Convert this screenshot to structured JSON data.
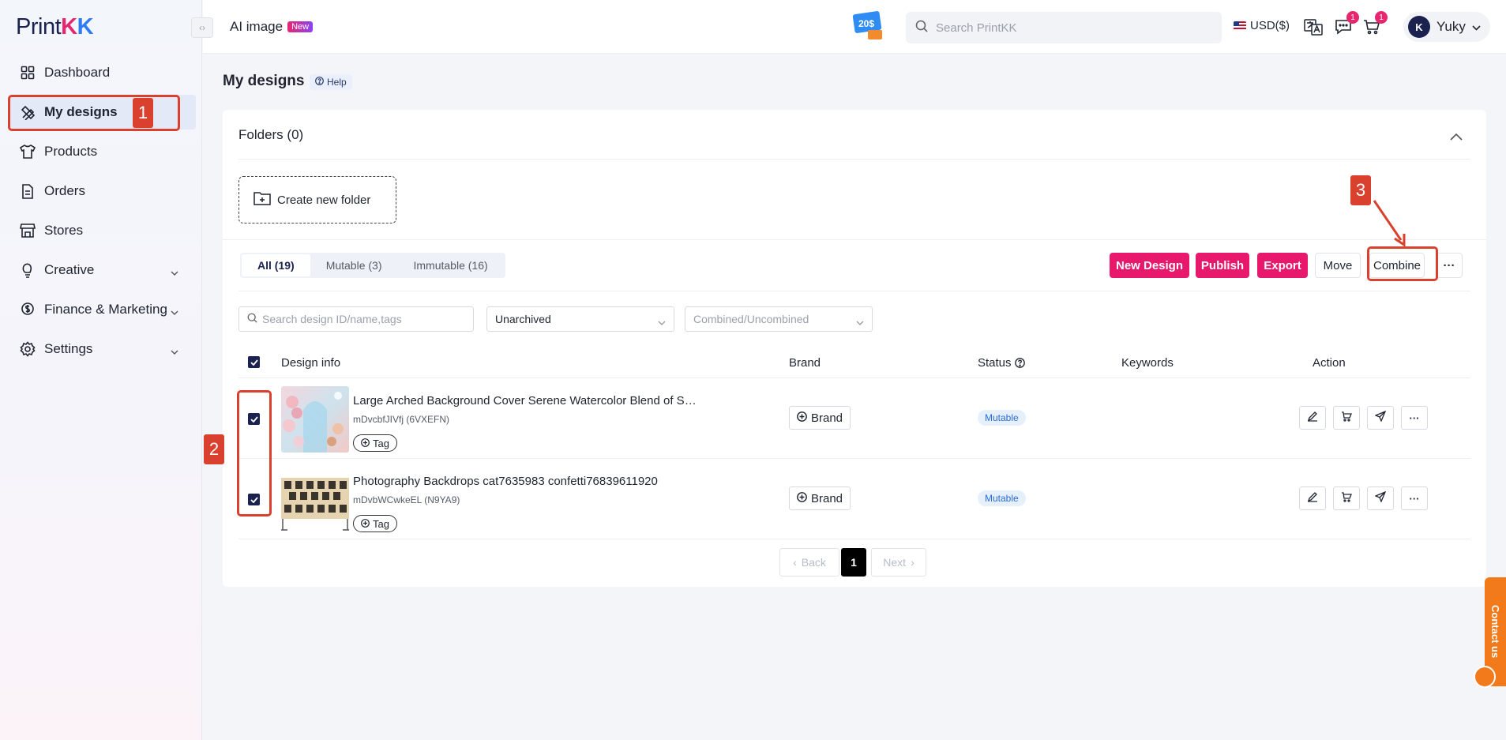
{
  "app": {
    "logo_text": "PrintKK",
    "logo_parts": [
      "Print",
      "K",
      "K"
    ]
  },
  "sidebar": {
    "items": [
      {
        "label": "Dashboard",
        "icon": "grid-icon"
      },
      {
        "label": "My designs",
        "icon": "pen-ruler-icon",
        "active": true
      },
      {
        "label": "Products",
        "icon": "tshirt-icon"
      },
      {
        "label": "Orders",
        "icon": "document-icon"
      },
      {
        "label": "Stores",
        "icon": "store-icon"
      },
      {
        "label": "Creative",
        "icon": "bulb-icon",
        "expandable": true
      },
      {
        "label": "Finance & Marketing",
        "icon": "dollar-icon",
        "expandable": true
      },
      {
        "label": "Settings",
        "icon": "gear-icon",
        "expandable": true
      }
    ]
  },
  "topbar": {
    "ai_image_label": "AI image",
    "new_badge": "New",
    "search_placeholder": "Search PrintKK",
    "currency": "USD($)",
    "messages_count": "1",
    "cart_count": "1",
    "user_name": "Yuky",
    "promo_text": "20$"
  },
  "page": {
    "title": "My designs",
    "help": "Help"
  },
  "folders": {
    "heading": "Folders (0)",
    "create_label": "Create new folder"
  },
  "tabs": [
    {
      "label": "All (19)",
      "active": true
    },
    {
      "label": "Mutable (3)"
    },
    {
      "label": "Immutable (16)"
    }
  ],
  "toolbar": {
    "new_design": "New Design",
    "publish": "Publish",
    "export": "Export",
    "move": "Move",
    "combine": "Combine",
    "more": "···"
  },
  "filters": {
    "search_placeholder": "Search design ID/name,tags",
    "archive_value": "Unarchived",
    "combined_placeholder": "Combined/Uncombined"
  },
  "table": {
    "columns": [
      "Design info",
      "Brand",
      "Status",
      "Keywords",
      "Action"
    ],
    "rows": [
      {
        "title": "Large Arched Background Cover Serene Watercolor Blend of Sea and Sunset...",
        "id": "mDvcbfJIVfj (6VXEFN)",
        "tag_label": "Tag",
        "brand_label": "Brand",
        "status": "Mutable",
        "checked": true
      },
      {
        "title": "Photography Backdrops cat7635983 confetti76839611920",
        "id": "mDvbWCwkeEL (N9YA9)",
        "tag_label": "Tag",
        "brand_label": "Brand",
        "status": "Mutable",
        "checked": true
      }
    ]
  },
  "pagination": {
    "back": "Back",
    "current": "1",
    "next": "Next"
  },
  "annotations": [
    "1",
    "2",
    "3"
  ],
  "contact": "Contact us",
  "colors": {
    "accent_pink": "#e8186d",
    "navy": "#1b2250",
    "annotation_red": "#d9412e",
    "contact_orange": "#f27a1a"
  }
}
